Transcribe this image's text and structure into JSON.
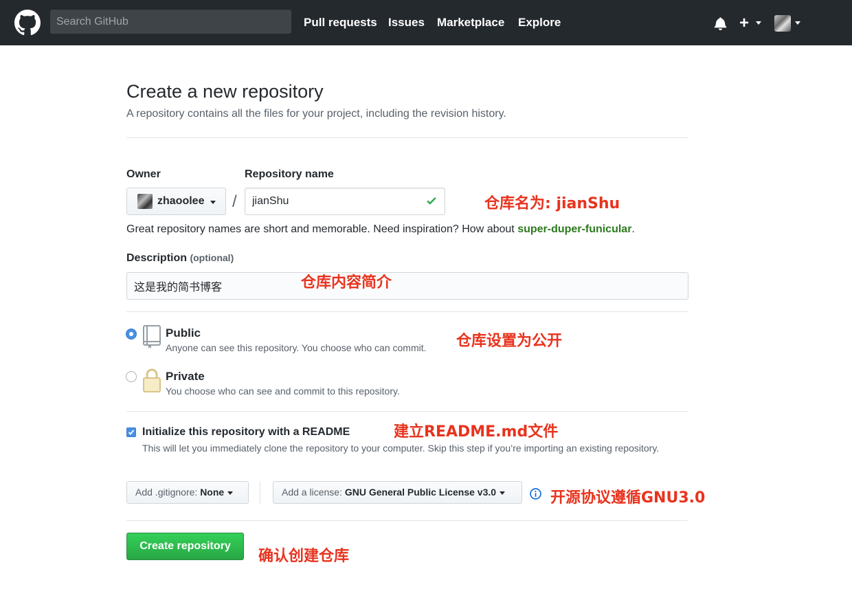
{
  "header": {
    "search_placeholder": "Search GitHub",
    "nav": [
      "Pull requests",
      "Issues",
      "Marketplace",
      "Explore"
    ],
    "icons": [
      "github-logo",
      "bell-icon",
      "plus-icon",
      "avatar"
    ]
  },
  "page": {
    "title": "Create a new repository",
    "subtitle": "A repository contains all the files for your project, including the revision history."
  },
  "form": {
    "owner_label": "Owner",
    "owner_value": "zhaoolee",
    "repo_label": "Repository name",
    "repo_value": "jianShu",
    "separator": "/",
    "hint_prefix": "Great repository names are short and memorable. Need inspiration? How about ",
    "hint_suggestion": "super-duper-funicular",
    "hint_suffix": ".",
    "description_label": "Description",
    "description_optional": "(optional)",
    "description_value": "这是我的简书博客",
    "public_title": "Public",
    "public_desc": "Anyone can see this repository. You choose who can commit.",
    "private_title": "Private",
    "private_desc": "You choose who can see and commit to this repository.",
    "visibility_selected": "Public",
    "readme_checked": true,
    "readme_title": "Initialize this repository with a README",
    "readme_desc": "This will let you immediately clone the repository to your computer. Skip this step if you’re importing an existing repository.",
    "gitignore_label": "Add .gitignore:",
    "gitignore_value": "None",
    "license_label": "Add a license:",
    "license_value": "GNU General Public License v3.0",
    "submit_label": "Create repository"
  },
  "annotations": {
    "repo_name_note": "仓库名为: jianShu",
    "description_note": "仓库内容简介",
    "public_note": "仓库设置为公开",
    "readme_note": "建立README.md文件",
    "license_note": "开源协议遵循GNU3.0",
    "submit_note": "确认创建仓库"
  },
  "colors": {
    "header_bg": "#24292e",
    "primary_button": "#28a745",
    "annotation": "#e8331e",
    "suggestion": "#2c7a1e"
  }
}
